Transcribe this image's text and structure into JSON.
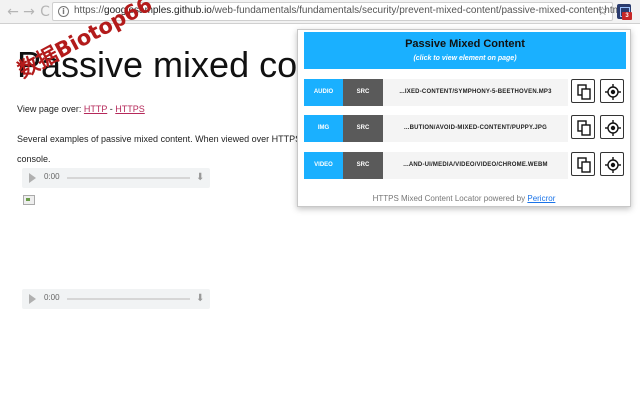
{
  "browser": {
    "url_prefix": "https://",
    "url_host": "googlesamples.github.io",
    "url_path": "/web-fundamentals/fundamentals/security/prevent-mixed-content/passive-mixed-content.html",
    "back_glyph": "←",
    "forward_glyph": "→",
    "reload_glyph": "C",
    "star_glyph": "☆",
    "info_glyph": "i"
  },
  "page": {
    "title": "Passive mixed conte",
    "view_prefix": "View page over:",
    "link_http": "HTTP",
    "separator": "-",
    "link_https": "HTTPS",
    "description": "Several examples of passive mixed content. When viewed over HTTPS c console.",
    "watermark": "数据Biotop66"
  },
  "audio_players": [
    {
      "time": "0:00"
    },
    {
      "time": "0:00"
    }
  ],
  "popup": {
    "title": "Passive Mixed Content",
    "subtitle": "(click to view element on page)",
    "rows": [
      {
        "type": "AUDIO",
        "attr": "SRC",
        "url": "...IXED-CONTENT/SYMPHONY-5-BEETHOVEN.MP3"
      },
      {
        "type": "IMG",
        "attr": "SRC",
        "url": "...BUTION/AVOID-MIXED-CONTENT/PUPPY.JPG"
      },
      {
        "type": "VIDEO",
        "attr": "SRC",
        "url": "...AND-UI/MEDIA/VIDEO/VIDEO/CHROME.WEBM"
      }
    ],
    "footer_text": "HTTPS Mixed Content Locator powered by",
    "footer_link": "Pericror"
  },
  "extension": {
    "badge": "3"
  },
  "colors": {
    "accent": "#1ab0ff",
    "attr_bg": "#5a5a5a",
    "link": "#b5285a"
  }
}
